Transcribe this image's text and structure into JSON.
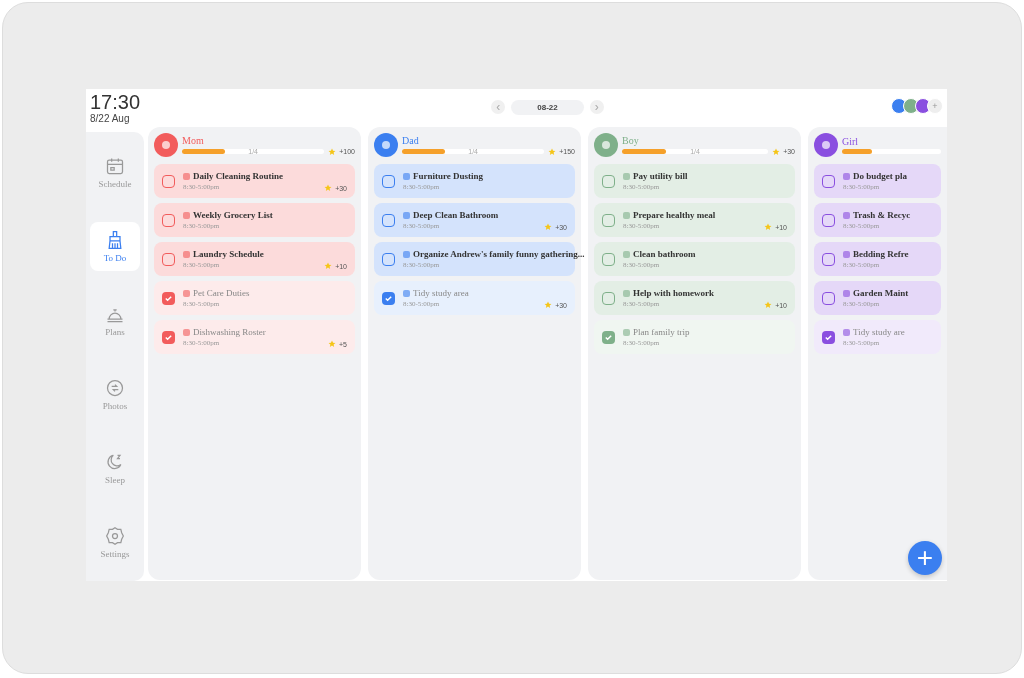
{
  "clock": {
    "time": "17:30",
    "date": "8/22 Aug"
  },
  "nav": [
    {
      "label": "Schedule",
      "selected": false
    },
    {
      "label": "To Do",
      "selected": true
    },
    {
      "label": "Plans",
      "selected": false
    },
    {
      "label": "Photos",
      "selected": false
    },
    {
      "label": "Sleep",
      "selected": false
    },
    {
      "label": "Settings",
      "selected": false
    }
  ],
  "date_nav": {
    "prev": "‹",
    "date": "08-22",
    "next": "›"
  },
  "members_bar": [
    {
      "color": "#3b7ff0"
    },
    {
      "color": "#7fb08a"
    },
    {
      "color": "#8a4fe0"
    }
  ],
  "members_more": "+",
  "columns": [
    {
      "name": "Mom",
      "color": "#f25c5c",
      "progress": "1/4",
      "level": 0.3,
      "points": "+100",
      "tasks": [
        {
          "title": "Daily Cleaning Routine",
          "time": "8:30-5:00pm",
          "points": "+30",
          "checked": false
        },
        {
          "title": "Weekly Grocery List",
          "time": "8:30-5:00pm",
          "checked": false
        },
        {
          "title": "Laundry Schedule",
          "time": "8:30-5:00pm",
          "points": "+10",
          "checked": false
        },
        {
          "title": "Pet Care Duties",
          "time": "8:30-5:00pm",
          "checked": true
        },
        {
          "title": "Dishwashing Roster",
          "time": "8:30-5:00pm",
          "points": "+5",
          "checked": true
        }
      ]
    },
    {
      "name": "Dad",
      "color": "#3b7ff0",
      "progress": "1/4",
      "level": 0.3,
      "points": "+150",
      "tasks": [
        {
          "title": "Furniture Dusting",
          "time": "8:30-5:00pm",
          "checked": false
        },
        {
          "title": "Deep Clean Bathroom",
          "time": "8:30-5:00pm",
          "points": "+30",
          "checked": false
        },
        {
          "title": "Organize Andrew's family funny gathering...",
          "time": "8:30-5:00pm",
          "checked": false
        },
        {
          "title": "Tidy study area",
          "time": "8:30-5:00pm",
          "points": "+30",
          "checked": true
        }
      ]
    },
    {
      "name": "Boy",
      "color": "#7fb08a",
      "progress": "1/4",
      "level": 0.3,
      "points": "+30",
      "tasks": [
        {
          "title": "Pay utility bill",
          "time": "8:30-5:00pm",
          "checked": false
        },
        {
          "title": "Prepare healthy meal",
          "time": "8:30-5:00pm",
          "points": "+10",
          "checked": false
        },
        {
          "title": "Clean bathroom",
          "time": "8:30-5:00pm",
          "checked": false
        },
        {
          "title": "Help with homework",
          "time": "8:30-5:00pm",
          "points": "+10",
          "checked": false
        },
        {
          "title": "Plan family trip",
          "time": "8:30-5:00pm",
          "checked": true
        }
      ]
    },
    {
      "name": "Girl",
      "color": "#8a4fe0",
      "level": 0.3,
      "tasks": [
        {
          "title": "Do budget pla",
          "time": "8:30-5:00pm",
          "checked": false
        },
        {
          "title": "Trash & Recyc",
          "time": "8:30-5:00pm",
          "checked": false
        },
        {
          "title": "Bedding Refre",
          "time": "8:30-5:00pm",
          "checked": false
        },
        {
          "title": "Garden Maint",
          "time": "8:30-5:00pm",
          "checked": false
        },
        {
          "title": "Tidy study are",
          "time": "8:30-5:00pm",
          "checked": true
        }
      ]
    }
  ],
  "add_button": "+"
}
